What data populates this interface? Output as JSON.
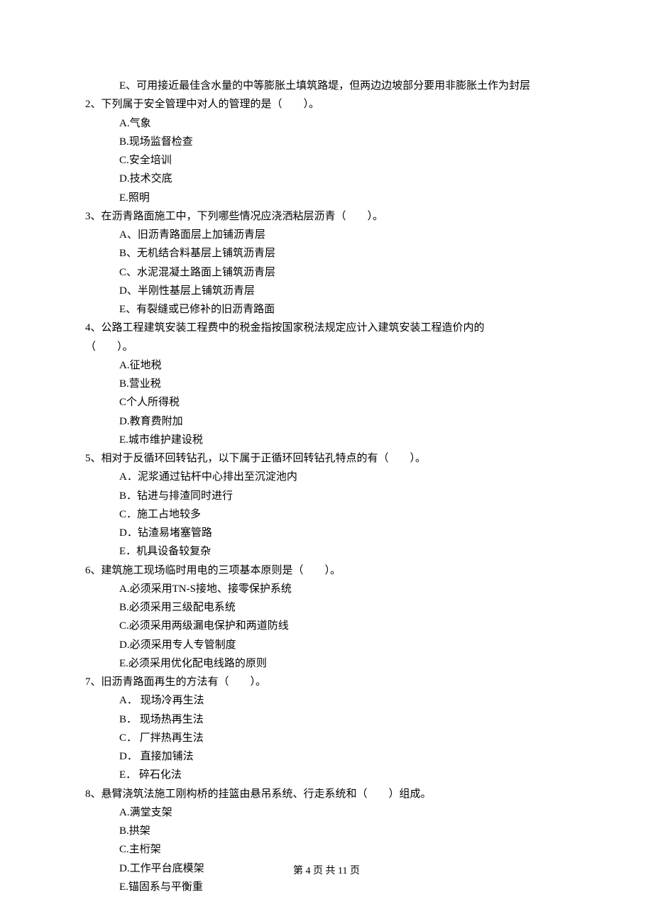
{
  "q1_optE": "E、可用接近最佳含水量的中等膨胀土填筑路堤，但两边边坡部分要用非膨胀土作为封层",
  "q2": "2、下列属于安全管理中对人的管理的是（　　）。",
  "q2_A": "A.气象",
  "q2_B": "B.现场监督检查",
  "q2_C": "C.安全培训",
  "q2_D": "D.技术交底",
  "q2_E": "E.照明",
  "q3": "3、在沥青路面施工中，下列哪些情况应浇洒粘层沥青（　　）。",
  "q3_A": "A、旧沥青路面层上加铺沥青层",
  "q3_B": "B、无机结合料基层上铺筑沥青层",
  "q3_C": "C、水泥混凝土路面上铺筑沥青层",
  "q3_D": "D、半刚性基层上铺筑沥青层",
  "q3_E": "E、有裂缝或已修补的旧沥青路面",
  "q4_line1": "4、公路工程建筑安装工程费中的税金指按国家税法规定应计入建筑安装工程造价内的",
  "q4_line2": "（　　）。",
  "q4_A": "A.征地税",
  "q4_B": "B.营业税",
  "q4_C": "C个人所得税",
  "q4_D": "D.教育费附加",
  "q4_E": "E.城市维护建设税",
  "q5": "5、相对于反循环回转钻孔，以下属于正循环回转钻孔特点的有（　　）。",
  "q5_A": "A．泥浆通过钻杆中心排出至沉淀池内",
  "q5_B": "B．钻进与排渣同时进行",
  "q5_C": "C．施工占地较多",
  "q5_D": "D．钻渣易堵塞管路",
  "q5_E": "E．机具设备较复杂",
  "q6": "6、建筑施工现场临时用电的三项基本原则是（　　）。",
  "q6_A": "A.必须采用TN-S接地、接零保护系统",
  "q6_B": "B.必须采用三级配电系统",
  "q6_C": "C.必须采用两级漏电保护和两道防线",
  "q6_D": "D.必须采用专人专管制度",
  "q6_E": "E.必须采用优化配电线路的原则",
  "q7": "7、旧沥青路面再生的方法有（　　）。",
  "q7_A": "A． 现场冷再生法",
  "q7_B": "B． 现场热再生法",
  "q7_C": "C． 厂拌热再生法",
  "q7_D": "D． 直接加铺法",
  "q7_E": "E． 碎石化法",
  "q8": "8、悬臂浇筑法施工刚构桥的挂篮由悬吊系统、行走系统和（　　）组成。",
  "q8_A": "A.满堂支架",
  "q8_B": "B.拱架",
  "q8_C": "C.主桁架",
  "q8_D": "D.工作平台底模架",
  "q8_E": "E.锚固系与平衡重",
  "footer": "第 4 页 共 11 页"
}
